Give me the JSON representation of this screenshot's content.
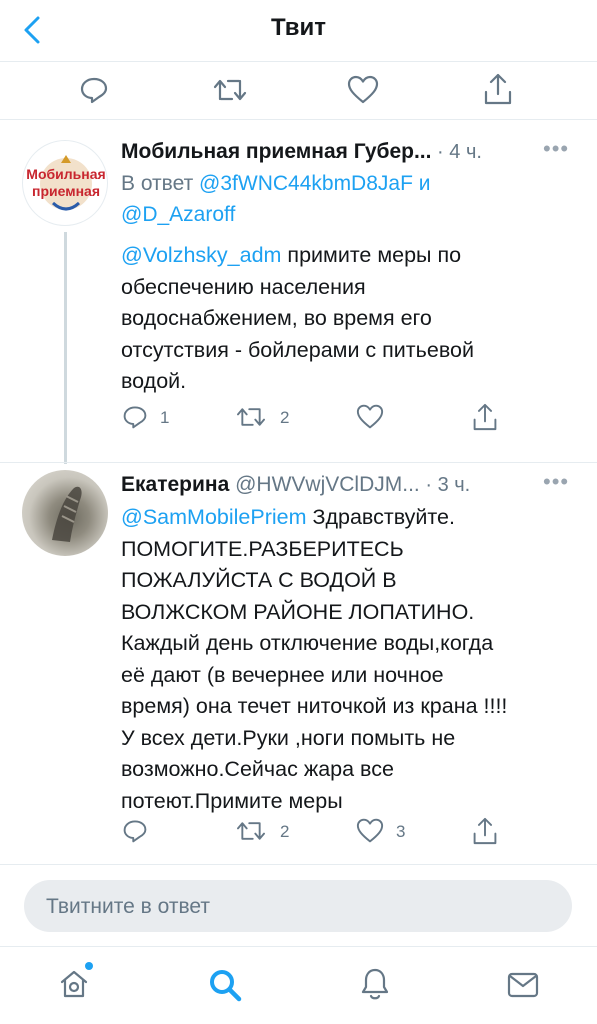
{
  "header": {
    "title": "Твит",
    "back_icon": "chevron-left-icon"
  },
  "top_actions": {
    "icons": [
      "reply-icon",
      "retweet-icon",
      "like-icon",
      "share-icon"
    ]
  },
  "tweets": [
    {
      "name": "Мобильная приемная Губер...",
      "handle": "",
      "dot": "·",
      "time": "4 ч.",
      "more": "•••",
      "avatar_text": "Мобильная приемная",
      "reply_prefix": "В ответ",
      "reply_to_1": "@3fWNC44kbmD8JaF",
      "reply_and": "и",
      "reply_to_2": "@D_Azaroff",
      "mention": "@Volzhsky_adm",
      "text_line1": " примите меры по",
      "text_rest": [
        "обеспечению населения",
        "водоснабжением, во время его",
        "отсутствия - бойлерами с питьевой",
        "водой."
      ],
      "replies": "1",
      "retweets": "2",
      "likes": ""
    },
    {
      "name": "Екатерина",
      "handle": "@HWVwjVClDJM...",
      "dot": "·",
      "time": "3 ч.",
      "more": "•••",
      "mention": "@SamMobilePriem",
      "text_line1": " Здравствуйте.",
      "text_rest": [
        "ПОМОГИТЕ.РАЗБЕРИТЕСЬ",
        "ПОЖАЛУЙСТА С ВОДОЙ В",
        "ВОЛЖСКОМ РАЙОНЕ ЛОПАТИНО.",
        "Каждый день отключение воды,когда",
        "её дают (в вечернее или ночное",
        "время) она течет ниточкой из крана !!!!",
        "У всех дети.Руки ,ноги помыть не",
        "возможно.Сейчас жара все",
        "потеют.Примите меры"
      ],
      "replies": "",
      "retweets": "2",
      "likes": "3"
    }
  ],
  "composer": {
    "placeholder": "Твитните в ответ"
  },
  "bottom_nav": {
    "icons": [
      "home-icon",
      "search-icon",
      "notifications-icon",
      "messages-icon"
    ]
  },
  "colors": {
    "accent": "#1da1f2",
    "muted": "#657786",
    "divider": "#e6ecf0"
  }
}
